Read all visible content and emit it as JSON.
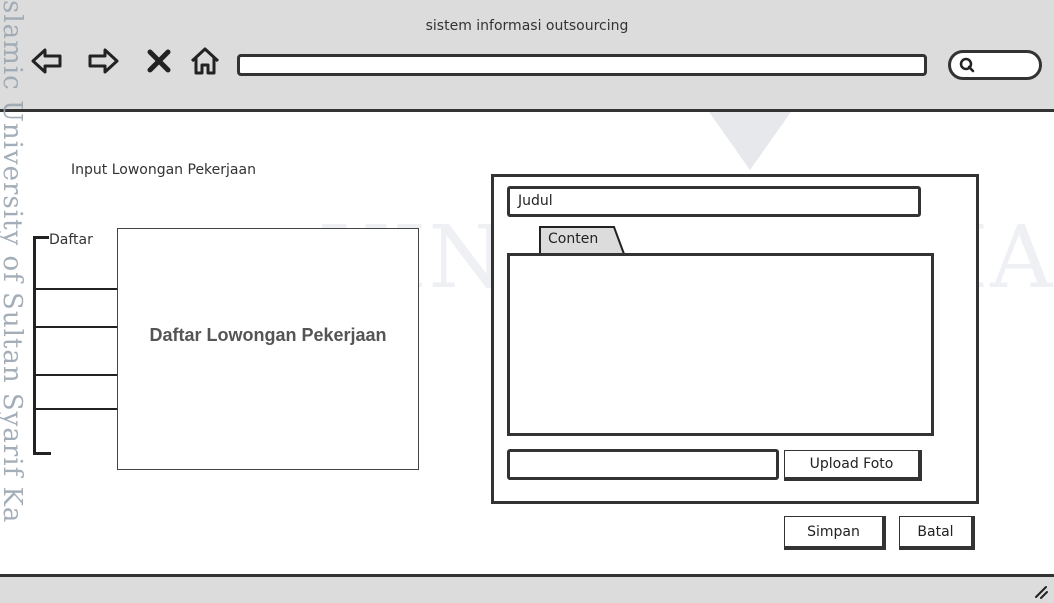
{
  "window": {
    "title": "sistem informasi outsourcing"
  },
  "toolbar": {
    "back_icon": "back-arrow-icon",
    "forward_icon": "forward-arrow-icon",
    "stop_icon": "close-icon",
    "home_icon": "home-icon",
    "search_icon": "search-icon",
    "address_value": ""
  },
  "watermark": {
    "side_text": "slamic University of Sultan Syarif Ka",
    "center_text": "UIN SUSKA RIAU"
  },
  "page": {
    "title": "Input Lowongan Pekerjaan"
  },
  "list": {
    "group_label": "Daftar",
    "panel_title": "Daftar Lowongan Pekerjaan"
  },
  "form": {
    "judul_value": "Judul",
    "tab_label": "Conten",
    "content_value": "",
    "file_value": "",
    "upload_label": "Upload Foto",
    "save_label": "Simpan",
    "cancel_label": "Batal"
  },
  "colors": {
    "chrome": "#dcdcdc",
    "ink": "#333333",
    "watermark": "#9aa6b2"
  }
}
